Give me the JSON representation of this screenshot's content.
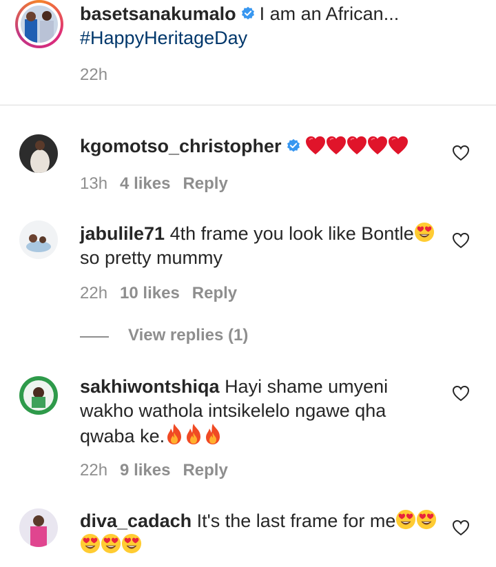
{
  "caption": {
    "username": "basetsanakumalo",
    "text": "I am an African...",
    "hashtag": "#HappyHeritageDay",
    "time": "22h"
  },
  "comments": [
    {
      "username": "kgomotso_christopher",
      "text": "",
      "emoji": "❤❤❤❤❤",
      "time": "13h",
      "likes": "4 likes",
      "reply": "Reply"
    },
    {
      "username": "jabulile71",
      "text_line1": "4th frame you look like Bontle",
      "text_line2": "so pretty mummy",
      "time": "22h",
      "likes": "10 likes",
      "reply": "Reply",
      "view_replies": "View replies (1)"
    },
    {
      "username": "sakhiwontshiqa",
      "text_line1": "Hayi shame umyeni",
      "text_line2": "wakho wathola intsikelelo ngawe qha",
      "text_line3": "qwaba ke.",
      "time": "22h",
      "likes": "9 likes",
      "reply": "Reply"
    },
    {
      "username": "diva_cadach",
      "text_line1": "It's the last frame for me",
      "text_line2": ""
    }
  ],
  "icons": {
    "like": "heart-outline-icon",
    "verified": "verified-badge-icon",
    "emoji_heart": "red-heart-emoji",
    "emoji_heart_eyes": "heart-eyes-emoji",
    "emoji_fire": "fire-emoji"
  },
  "colors": {
    "text": "#262626",
    "muted": "#8e8e8e",
    "hashtag": "#00376b",
    "verified": "#3897f0",
    "heart_emoji": "#e0142a"
  }
}
